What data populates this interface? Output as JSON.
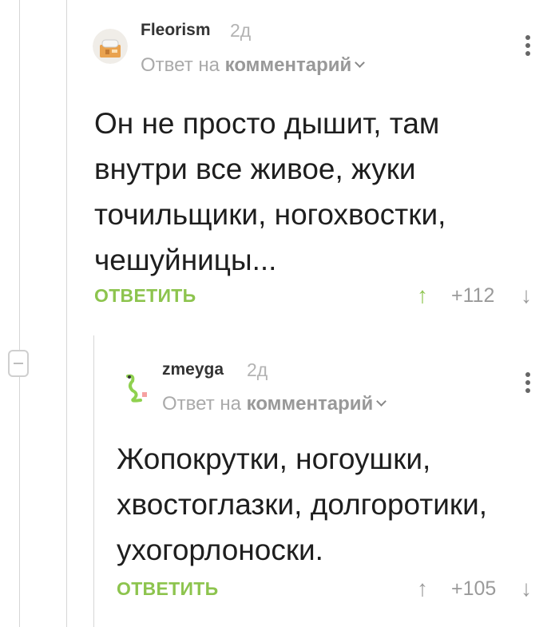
{
  "comments": [
    {
      "author": "Fleorism",
      "time": "2д",
      "reply_prefix": "Ответ на",
      "reply_link": "комментарий",
      "text": "Он не просто дышит, там внутри все живое, жуки точильщики, ногохвостки, чешуйницы...",
      "reply_label": "ОТВЕТИТЬ",
      "rating": "+112",
      "up_arrow": "↑",
      "down_arrow": "↓"
    },
    {
      "author": "zmeyga",
      "time": "2д",
      "reply_prefix": "Ответ на",
      "reply_link": "комментарий",
      "text": "Жопокрутки, ногоушки, хвостоглазки, долгоротики, ухогорлоноски.",
      "reply_label": "ОТВЕТИТЬ",
      "rating": "+105",
      "up_arrow": "↑",
      "down_arrow": "↓"
    }
  ],
  "colors": {
    "accent": "#8dc44e",
    "muted": "#9a9a9a",
    "line": "#d6d6d6"
  },
  "icons": {
    "collapse": "minus-icon",
    "more": "more-vertical-icon"
  }
}
